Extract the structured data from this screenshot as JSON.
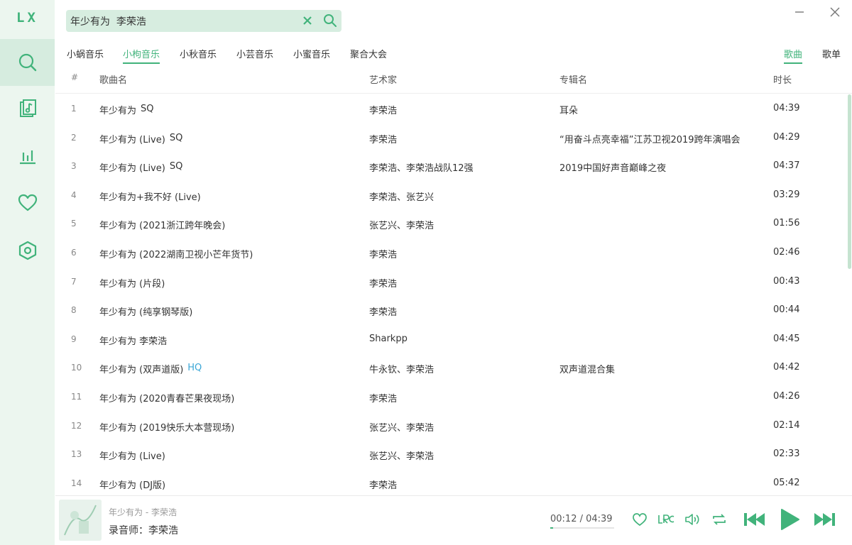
{
  "app": {
    "logo": "LX",
    "accent_color": "#41b37b"
  },
  "sidebar": {
    "items": [
      {
        "name": "search",
        "icon": "search-icon",
        "active": true
      },
      {
        "name": "song-list",
        "icon": "music-note-icon",
        "active": false
      },
      {
        "name": "leaderboard",
        "icon": "bar-chart-icon",
        "active": false
      },
      {
        "name": "my-list",
        "icon": "heart-icon",
        "active": false
      },
      {
        "name": "settings",
        "icon": "hexagon-settings-icon",
        "active": false
      }
    ]
  },
  "search": {
    "query": "年少有为  李荣浩"
  },
  "source_tabs": [
    {
      "label": "小蜗音乐",
      "active": false
    },
    {
      "label": "小枸音乐",
      "active": true
    },
    {
      "label": "小秋音乐",
      "active": false
    },
    {
      "label": "小芸音乐",
      "active": false
    },
    {
      "label": "小蜜音乐",
      "active": false
    },
    {
      "label": "聚合大会",
      "active": false
    }
  ],
  "type_tabs": [
    {
      "label": "歌曲",
      "active": true
    },
    {
      "label": "歌单",
      "active": false
    }
  ],
  "table": {
    "headers": {
      "index": "#",
      "name": "歌曲名",
      "artist": "艺术家",
      "album": "专辑名",
      "duration": "时长"
    },
    "rows": [
      {
        "index": "1",
        "name": "年少有为",
        "badge": "SQ",
        "artist": "李荣浩",
        "album": "耳朵",
        "duration": "04:39"
      },
      {
        "index": "2",
        "name": "年少有为 (Live)",
        "badge": "SQ",
        "artist": "李荣浩",
        "album": "“用奋斗点亮幸福”江苏卫视2019跨年演唱会",
        "duration": "04:29"
      },
      {
        "index": "3",
        "name": "年少有为 (Live)",
        "badge": "SQ",
        "artist": "李荣浩、李荣浩战队12强",
        "album": "2019中国好声音巅峰之夜",
        "duration": "04:37"
      },
      {
        "index": "4",
        "name": "年少有为+我不好 (Live)",
        "badge": "",
        "artist": "李荣浩、张艺兴",
        "album": "",
        "duration": "03:29"
      },
      {
        "index": "5",
        "name": "年少有为 (2021浙江跨年晚会)",
        "badge": "",
        "artist": "张艺兴、李荣浩",
        "album": "",
        "duration": "01:56"
      },
      {
        "index": "6",
        "name": "年少有为 (2022湖南卫视小芒年货节)",
        "badge": "",
        "artist": "李荣浩",
        "album": "",
        "duration": "02:46"
      },
      {
        "index": "7",
        "name": "年少有为 (片段)",
        "badge": "",
        "artist": "李荣浩",
        "album": "",
        "duration": "00:43"
      },
      {
        "index": "8",
        "name": "年少有为 (纯享钢琴版)",
        "badge": "",
        "artist": "李荣浩",
        "album": "",
        "duration": "00:44"
      },
      {
        "index": "9",
        "name": "年少有为 李荣浩",
        "badge": "",
        "artist": "Sharkpp",
        "album": "",
        "duration": "04:45"
      },
      {
        "index": "10",
        "name": "年少有为 (双声道版)",
        "badge": "HQ",
        "artist": "牛永钦、李荣浩",
        "album": "双声道混合集",
        "duration": "04:42"
      },
      {
        "index": "11",
        "name": "年少有为 (2020青春芒果夜现场)",
        "badge": "",
        "artist": "李荣浩",
        "album": "",
        "duration": "04:26"
      },
      {
        "index": "12",
        "name": "年少有为 (2019快乐大本营现场)",
        "badge": "",
        "artist": "张艺兴、李荣浩",
        "album": "",
        "duration": "02:14"
      },
      {
        "index": "13",
        "name": "年少有为 (Live)",
        "badge": "",
        "artist": "张艺兴、李荣浩",
        "album": "",
        "duration": "02:33"
      },
      {
        "index": "14",
        "name": "年少有为 (DJ版)",
        "badge": "",
        "artist": "李荣浩",
        "album": "",
        "duration": "05:42"
      }
    ]
  },
  "player": {
    "title": "年少有为 - 李荣浩",
    "lyric": "录音师：李荣浩",
    "time": "00:12 / 04:39",
    "progress": 0.043
  }
}
